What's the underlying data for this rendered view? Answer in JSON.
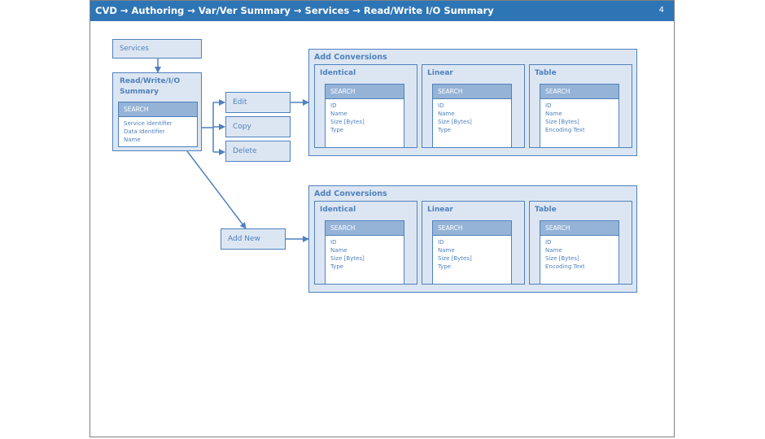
{
  "header": {
    "breadcrumb": "CVD → Authoring → Var/Ver Summary → Services → Read/Write I/O Summary",
    "page_number": "4"
  },
  "services": {
    "label": "Services"
  },
  "summary": {
    "title_line1": "Read/Write/I/O",
    "title_line2": "Summary",
    "search_label": "SEARCH",
    "fields": [
      "Service Identifier",
      "Data Identifier",
      "Name"
    ]
  },
  "actions": {
    "edit": "Edit",
    "copy": "Copy",
    "delete": "Delete",
    "add_new": "Add New"
  },
  "conversion_groups": [
    {
      "title": "Add Conversions",
      "panels": [
        {
          "title": "Identical",
          "search_label": "SEARCH",
          "fields": [
            "ID",
            "Name",
            "Size [Bytes]",
            "Type"
          ]
        },
        {
          "title": "Linear",
          "search_label": "SEARCH",
          "fields": [
            "ID",
            "Name",
            "Size [Bytes]",
            "Type"
          ]
        },
        {
          "title": "Table",
          "search_label": "SEARCH",
          "fields": [
            "ID",
            "Name",
            "Size [Bytes]",
            "Encoding Text"
          ]
        }
      ]
    },
    {
      "title": "Add Conversions",
      "panels": [
        {
          "title": "Identical",
          "search_label": "SEARCH",
          "fields": [
            "ID",
            "Name",
            "Size [Bytes]",
            "Type"
          ]
        },
        {
          "title": "Linear",
          "search_label": "SEARCH",
          "fields": [
            "ID",
            "Name",
            "Size [Bytes]",
            "Type"
          ]
        },
        {
          "title": "Table",
          "search_label": "SEARCH",
          "fields": [
            "ID",
            "Name",
            "Size [Bytes]",
            "Encoding Text"
          ]
        }
      ]
    }
  ]
}
